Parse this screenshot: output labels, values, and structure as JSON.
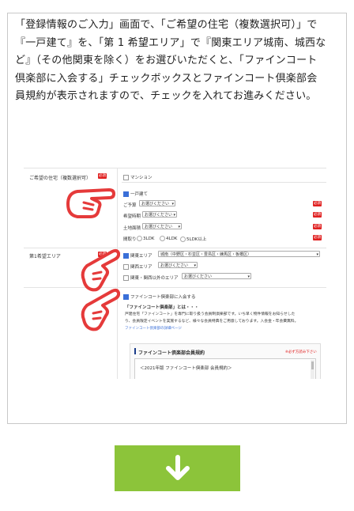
{
  "instruction": "「登録情報のご入力」画面で、「ご希望の住宅（複数選択可）」で『一戸建て』を、「第 1 希望エリア」で『関東エリア城南、城西など』（その他関東を除く）をお選びいただくと、「ファインコート倶楽部に入会する」チェックボックスとファインコート倶楽部会員規約が表示されますので、チェックを入れてお進みください。",
  "form": {
    "housing_label": "ご希望の住宅（複数選択可）",
    "required": "必須",
    "mansion": "マンション",
    "detached": "一戸建て",
    "budget_label": "ご予算",
    "period_label": "希望時期",
    "land_label": "土地面積",
    "floorplan_label": "間取り",
    "select_placeholder": "お選びください",
    "plan_3ldk": "3LDK",
    "plan_4ldk": "4LDK",
    "plan_5ldk": "5LDK以上",
    "area_label": "第1希望エリア",
    "kanto_area": "関東エリア",
    "kanto_area_value": "城南（中野区・杉並区・豊島区・練馬区・板橋区）",
    "kansai_area": "関西エリア",
    "other_area": "関東・関西以外のエリア",
    "club_checkbox": "ファインコート倶楽部に入会する",
    "club_what": "「ファインコート倶楽部」とは・・・",
    "club_desc_1": "戸建住宅「ファインコート」を専門に取り扱う会員制倶楽部です。いち早く物件情報をお知らせした",
    "club_desc_2": "り、会員限定イベントを実施するなど、様々な会員特典をご用意しております。入会金・年会費無料。",
    "club_link": "ファインコート倶楽部の詳細ページ",
    "terms_title": "ファインコート倶楽部会員規約",
    "terms_note": "※必ず方読み下さい",
    "terms_body": "＜2021年版 ファインコート倶楽部 会員規約＞"
  },
  "colors": {
    "accent_green": "#8cc43a",
    "required_red": "#e02020",
    "hand_red": "#e53a3a",
    "check_blue": "#3a6fd8"
  },
  "icons": {
    "pointer": "pointing-hand-icon",
    "next": "arrow-down-icon"
  }
}
